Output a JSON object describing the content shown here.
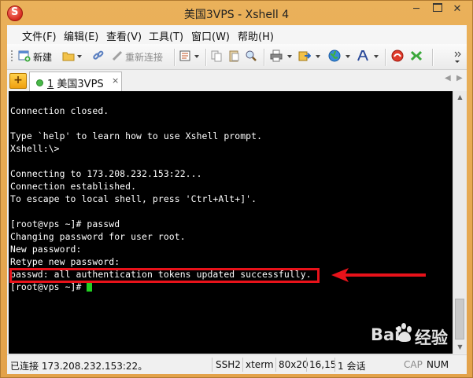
{
  "window": {
    "title": "美国3VPS - Xshell 4",
    "app_icon_glyph": "S",
    "controls": {
      "minimize": "─",
      "close": "✕"
    }
  },
  "menu": [
    "文件(F)",
    "编辑(E)",
    "查看(V)",
    "工具(T)",
    "窗口(W)",
    "帮助(H)"
  ],
  "toolbar": {
    "new_label": "新建",
    "reconnect_label": "重新连接",
    "icons": [
      "new-session-icon",
      "open-folder-icon",
      "link-icon",
      "reconnect-icon",
      "properties-icon",
      "copy-icon",
      "paste-icon",
      "find-icon",
      "print-icon",
      "transfer-icon",
      "globe-icon",
      "font-icon",
      "xftp-icon",
      "xmanager-icon",
      "more-icon"
    ]
  },
  "tab": {
    "plus": "+",
    "number": "1",
    "name": " 美国3VPS",
    "close": "×",
    "status_color": "#48b848"
  },
  "terminal": {
    "lines": [
      "",
      "Connection closed.",
      "",
      "Type `help' to learn how to use Xshell prompt.",
      "Xshell:\\>",
      "",
      "Connecting to 173.208.232.153:22...",
      "Connection established.",
      "To escape to local shell, press 'Ctrl+Alt+]'.",
      "",
      "[root@vps ~]# passwd",
      "Changing password for user root.",
      "New password:",
      "Retype new password:",
      "passwd: all authentication tokens updated successfully.",
      "[root@vps ~]# "
    ],
    "highlighted_line_index": 14,
    "cursor_color": "#22d022",
    "annotation_color": "#e8121a"
  },
  "statusbar": {
    "connection": "已连接 173.208.232.153:22。",
    "protocol": "SSH2",
    "term": "xterm",
    "size": "80x20",
    "position": "16,15",
    "sessions": "1 会话",
    "cap": "CAP",
    "num": "NUM"
  },
  "watermark": {
    "text_left": "Bai",
    "text_right": "经验"
  }
}
